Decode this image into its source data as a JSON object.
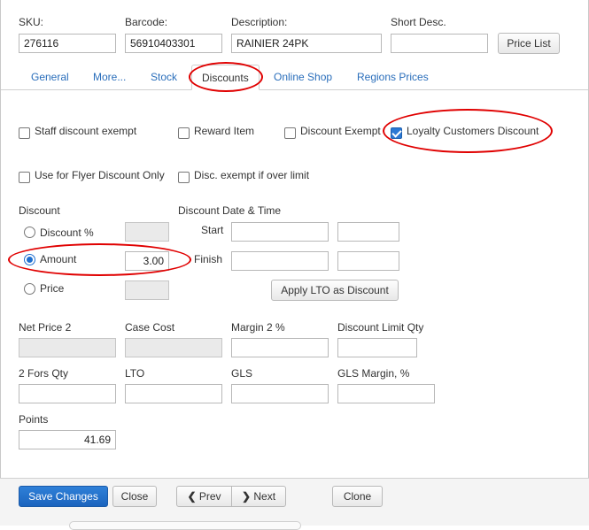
{
  "header": {
    "sku": {
      "label": "SKU:",
      "value": "276116"
    },
    "barcode": {
      "label": "Barcode:",
      "value": "56910403301"
    },
    "description": {
      "label": "Description:",
      "value": "RAINIER 24PK"
    },
    "short_desc": {
      "label": "Short Desc.",
      "value": ""
    },
    "price_list_label": "Price List"
  },
  "tabs": [
    {
      "label": "General"
    },
    {
      "label": "More..."
    },
    {
      "label": "Stock"
    },
    {
      "label": "Discounts",
      "active": true
    },
    {
      "label": "Online Shop"
    },
    {
      "label": "Regions Prices"
    }
  ],
  "flags": {
    "staff_discount_exempt": {
      "label": "Staff discount exempt",
      "checked": false
    },
    "reward_item": {
      "label": "Reward Item",
      "checked": false
    },
    "discount_exempt": {
      "label": "Discount Exempt",
      "checked": false
    },
    "loyalty_customers_discount": {
      "label": "Loyalty Customers Discount",
      "checked": true
    },
    "use_for_flyer": {
      "label": "Use for Flyer Discount Only",
      "checked": false
    },
    "disc_exempt_over_limit": {
      "label": "Disc. exempt if over limit",
      "checked": false
    }
  },
  "discount": {
    "section_label": "Discount",
    "options": [
      {
        "label": "Discount %",
        "value": "",
        "selected": false
      },
      {
        "label": "Amount",
        "value": "3.00",
        "selected": true
      },
      {
        "label": "Price",
        "value": "",
        "selected": false
      }
    ]
  },
  "discount_date": {
    "section_label": "Discount Date & Time",
    "start_label": "Start",
    "finish_label": "Finish",
    "apply_lto_label": "Apply LTO as Discount"
  },
  "fields": {
    "net_price_2": {
      "label": "Net Price 2",
      "value": ""
    },
    "case_cost": {
      "label": "Case Cost",
      "value": ""
    },
    "margin_2": {
      "label": "Margin 2 %",
      "value": ""
    },
    "discount_limit_qty": {
      "label": "Discount Limit Qty",
      "value": ""
    },
    "two_fors_qty": {
      "label": "2 Fors Qty",
      "value": ""
    },
    "lto": {
      "label": "LTO",
      "value": ""
    },
    "gls": {
      "label": "GLS",
      "value": ""
    },
    "gls_margin": {
      "label": "GLS Margin, %",
      "value": ""
    },
    "points": {
      "label": "Points",
      "value": "41.69"
    }
  },
  "footer": {
    "save_label": "Save Changes",
    "close_label": "Close",
    "prev_label": "Prev",
    "next_label": "Next",
    "clone_label": "Clone"
  },
  "icons": {
    "prev": "chevron-left-icon",
    "next": "chevron-right-icon"
  },
  "colors": {
    "accent": "#1b64be",
    "link": "#2a6ebb",
    "annotation": "#e00000"
  }
}
